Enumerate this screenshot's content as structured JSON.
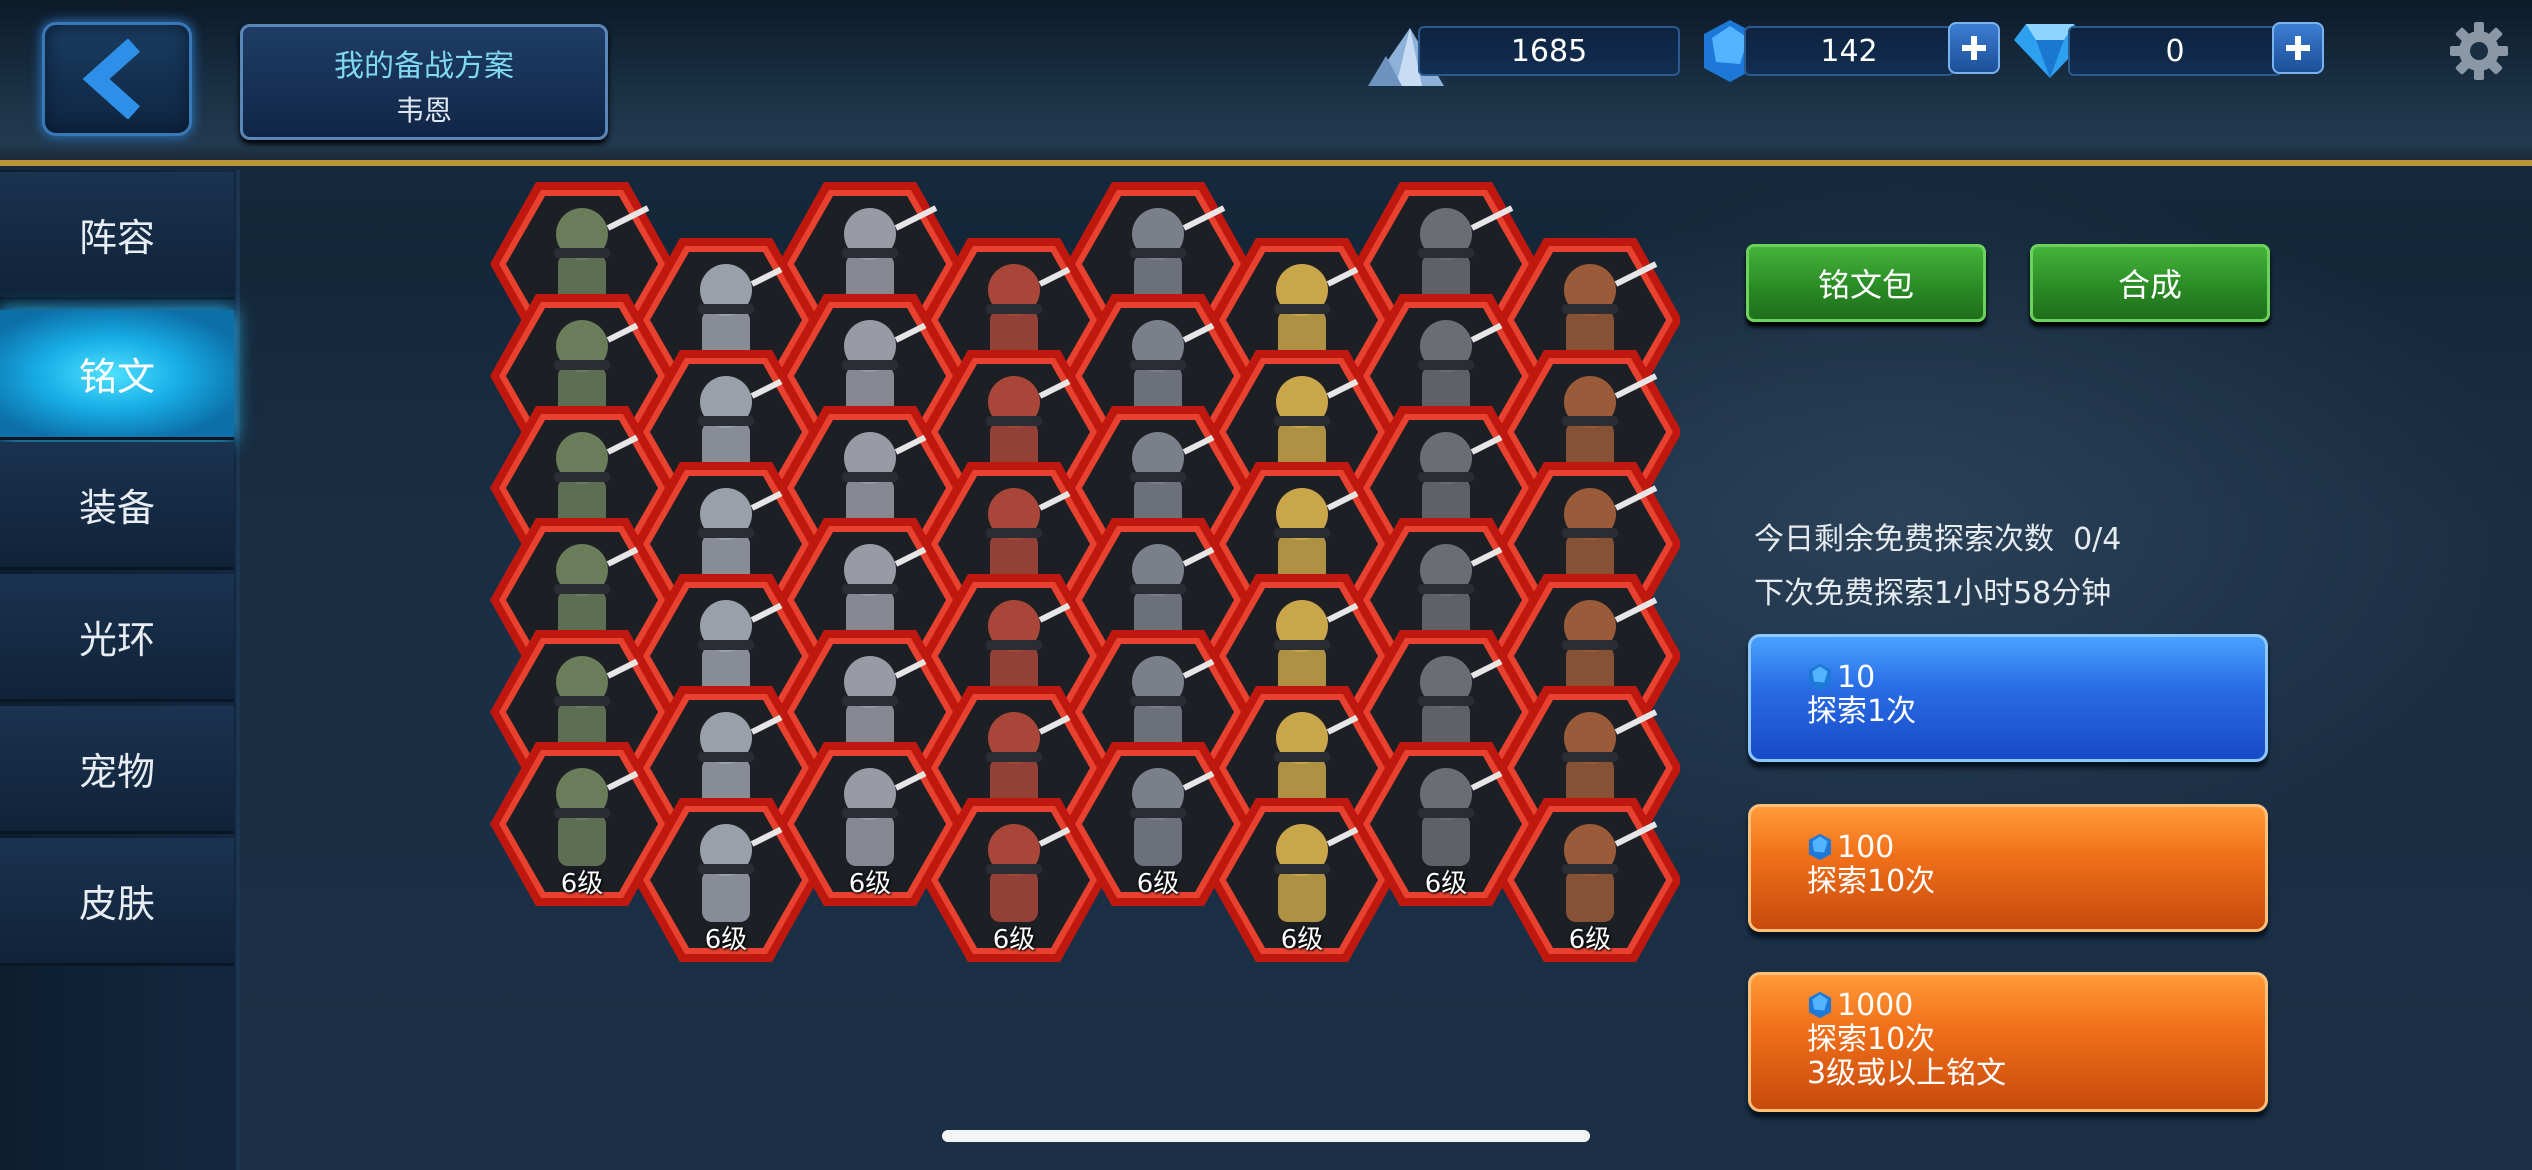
{
  "header": {
    "plan_title": "我的备战方案",
    "plan_name": "韦恩",
    "resources": [
      {
        "icon": "silver-crystal-icon",
        "value": "1685",
        "has_plus": false
      },
      {
        "icon": "blue-gem-icon",
        "value": "142",
        "has_plus": true
      },
      {
        "icon": "diamond-icon",
        "value": "0",
        "has_plus": true
      }
    ]
  },
  "sidebar": {
    "items": [
      {
        "label": "阵容",
        "active": false
      },
      {
        "label": "铭文",
        "active": true
      },
      {
        "label": "装备",
        "active": false
      },
      {
        "label": "光环",
        "active": false
      },
      {
        "label": "宠物",
        "active": false
      },
      {
        "label": "皮肤",
        "active": false
      }
    ]
  },
  "inscriptions": {
    "level_label": "6级",
    "columns": [
      {
        "hero": "sword-knight-icon",
        "count": 6
      },
      {
        "hero": "armored-paladin-icon",
        "count": 6
      },
      {
        "hero": "greatsword-knight-icon",
        "count": 6
      },
      {
        "hero": "red-robed-mage-icon",
        "count": 6
      },
      {
        "hero": "cavalry-rider-icon",
        "count": 6
      },
      {
        "hero": "blonde-warrior-icon",
        "count": 6
      },
      {
        "hero": "ninja-icon",
        "count": 6
      },
      {
        "hero": "samurai-icon",
        "count": 6
      }
    ]
  },
  "actions": {
    "pack_label": "铭文包",
    "merge_label": "合成",
    "free_remaining_label": "今日剩余免费探索次数",
    "free_remaining_value": "0/4",
    "next_free_label": "下次免费探索1小时58分钟",
    "explore": [
      {
        "cost": "10",
        "lines": [
          "探索1次"
        ],
        "color": "blue"
      },
      {
        "cost": "100",
        "lines": [
          "探索10次"
        ],
        "color": "orange"
      },
      {
        "cost": "1000",
        "lines": [
          "探索10次",
          "3级或以上铭文"
        ],
        "color": "orange"
      }
    ]
  },
  "colors": {
    "hex_border": "#e0291c",
    "active_tab": "#1bb4ee",
    "green_button": "#2f9a2a"
  }
}
